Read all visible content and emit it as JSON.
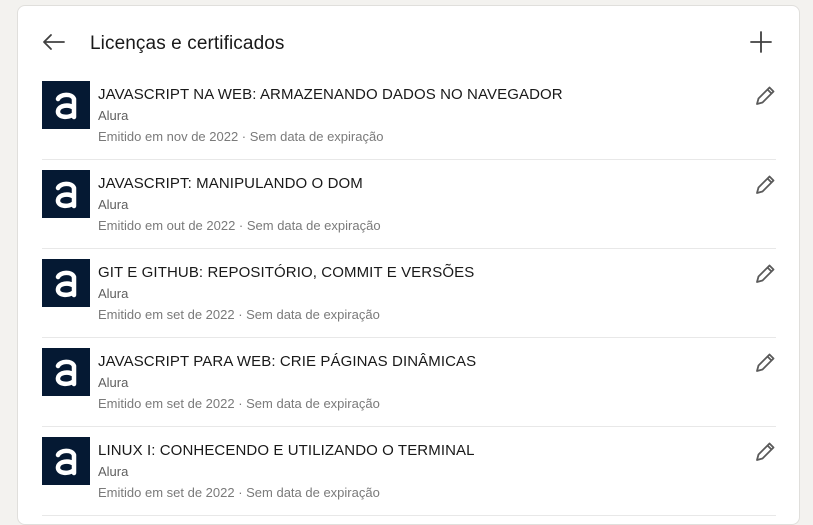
{
  "header": {
    "title": "Licenças e certificados",
    "back_icon": "arrow-left-icon",
    "add_icon": "plus-icon"
  },
  "colors": {
    "logo_bg": "#051933",
    "card_bg": "#ffffff",
    "page_bg": "#f3f2ef"
  },
  "certificates": [
    {
      "name": "JAVASCRIPT NA WEB: ARMAZENANDO DADOS NO NAVEGADOR",
      "issuer": "Alura",
      "meta": "Emitido em nov de 2022 · Sem data de expiração"
    },
    {
      "name": "JAVASCRIPT: MANIPULANDO O DOM",
      "issuer": "Alura",
      "meta": "Emitido em out de 2022 · Sem data de expiração"
    },
    {
      "name": "GIT E GITHUB: REPOSITÓRIO, COMMIT E VERSÕES",
      "issuer": "Alura",
      "meta": "Emitido em set de 2022 · Sem data de expiração"
    },
    {
      "name": "JAVASCRIPT PARA WEB: CRIE PÁGINAS DINÂMICAS",
      "issuer": "Alura",
      "meta": "Emitido em set de 2022 · Sem data de expiração"
    },
    {
      "name": "LINUX I: CONHECENDO E UTILIZANDO O TERMINAL",
      "issuer": "Alura",
      "meta": "Emitido em set de 2022 · Sem data de expiração"
    }
  ]
}
